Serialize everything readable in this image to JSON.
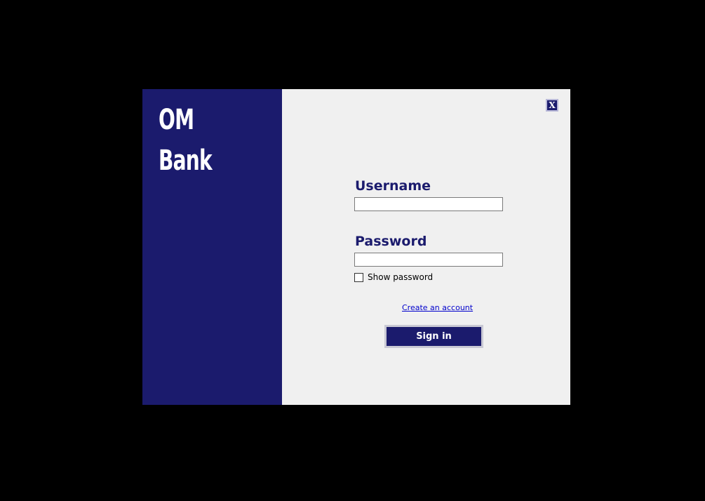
{
  "brand": {
    "line1": "OM",
    "line2": "Bank"
  },
  "window": {
    "close_label": "X"
  },
  "form": {
    "username_label": "Username",
    "username_value": "",
    "password_label": "Password",
    "password_value": "",
    "show_password_label": "Show password",
    "show_password_checked": false,
    "create_account_link": "Create an account",
    "sign_in_label": "Sign in"
  },
  "colors": {
    "background": "#000000",
    "brand_panel": "#1b1b6d",
    "form_panel": "#f0f0f0",
    "accent_text": "#1b1b6d",
    "link": "#0000cc"
  }
}
